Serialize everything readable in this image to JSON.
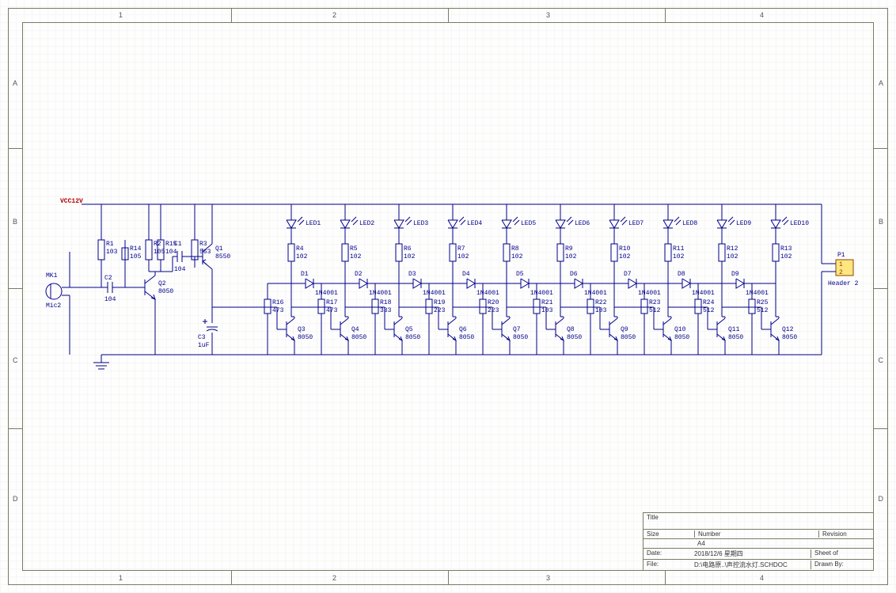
{
  "power": {
    "vcc": "VCC12V"
  },
  "mic": {
    "ref": "MK1",
    "name": "Mic2"
  },
  "pre": {
    "R1": {
      "ref": "R1",
      "val": "103"
    },
    "C2": {
      "ref": "C2",
      "val": "104"
    },
    "R2": {
      "ref": "R2",
      "val": "105"
    },
    "R14": {
      "ref": "R14",
      "val": "105"
    },
    "R15": {
      "ref": "R15",
      "val": "104"
    },
    "Q2": {
      "ref": "Q2",
      "val": "8050"
    },
    "C1": {
      "ref": "C1",
      "val": "104"
    },
    "R3": {
      "ref": "R3",
      "val": "563"
    },
    "Q1": {
      "ref": "Q1",
      "val": "8550"
    },
    "C3": {
      "ref": "C3",
      "val": "1uF"
    }
  },
  "stages": [
    {
      "led": "LED1",
      "Rtop": {
        "ref": "R4",
        "val": "102"
      },
      "Rdrv": {
        "ref": "R16",
        "val": "473"
      },
      "D": {
        "ref": "D1",
        "val": "1N4001"
      },
      "Q": {
        "ref": "Q3",
        "val": "8050"
      }
    },
    {
      "led": "LED2",
      "Rtop": {
        "ref": "R5",
        "val": "102"
      },
      "Rdrv": {
        "ref": "R17",
        "val": "473"
      },
      "D": {
        "ref": "D2",
        "val": "1N4001"
      },
      "Q": {
        "ref": "Q4",
        "val": "8050"
      }
    },
    {
      "led": "LED3",
      "Rtop": {
        "ref": "R6",
        "val": "102"
      },
      "Rdrv": {
        "ref": "R18",
        "val": "333"
      },
      "D": {
        "ref": "D3",
        "val": "1N4001"
      },
      "Q": {
        "ref": "Q5",
        "val": "8050"
      }
    },
    {
      "led": "LED4",
      "Rtop": {
        "ref": "R7",
        "val": "102"
      },
      "Rdrv": {
        "ref": "R19",
        "val": "223"
      },
      "D": {
        "ref": "D4",
        "val": "1N4001"
      },
      "Q": {
        "ref": "Q6",
        "val": "8050"
      }
    },
    {
      "led": "LED5",
      "Rtop": {
        "ref": "R8",
        "val": "102"
      },
      "Rdrv": {
        "ref": "R20",
        "val": "223"
      },
      "D": {
        "ref": "D5",
        "val": "1N4001"
      },
      "Q": {
        "ref": "Q7",
        "val": "8050"
      }
    },
    {
      "led": "LED6",
      "Rtop": {
        "ref": "R9",
        "val": "102"
      },
      "Rdrv": {
        "ref": "R21",
        "val": "103"
      },
      "D": {
        "ref": "D6",
        "val": "1N4001"
      },
      "Q": {
        "ref": "Q8",
        "val": "8050"
      }
    },
    {
      "led": "LED7",
      "Rtop": {
        "ref": "R10",
        "val": "102"
      },
      "Rdrv": {
        "ref": "R22",
        "val": "103"
      },
      "D": {
        "ref": "D7",
        "val": "1N4001"
      },
      "Q": {
        "ref": "Q9",
        "val": "8050"
      }
    },
    {
      "led": "LED8",
      "Rtop": {
        "ref": "R11",
        "val": "102"
      },
      "Rdrv": {
        "ref": "R23",
        "val": "512"
      },
      "D": {
        "ref": "D8",
        "val": "1N4001"
      },
      "Q": {
        "ref": "Q10",
        "val": "8050"
      }
    },
    {
      "led": "LED9",
      "Rtop": {
        "ref": "R12",
        "val": "102"
      },
      "Rdrv": {
        "ref": "R24",
        "val": "512"
      },
      "D": {
        "ref": "D9",
        "val": "1N4001"
      },
      "Q": {
        "ref": "Q11",
        "val": "8050"
      }
    },
    {
      "led": "LED10",
      "Rtop": {
        "ref": "R13",
        "val": "102"
      },
      "Rdrv": {
        "ref": "R25",
        "val": "512"
      },
      "D": null,
      "Q": {
        "ref": "Q12",
        "val": "8050"
      }
    }
  ],
  "conn": {
    "ref": "P1",
    "pins": [
      "1",
      "2"
    ],
    "name": "Header 2"
  },
  "title_block": {
    "title_lbl": "Title",
    "title": "",
    "size_lbl": "Size",
    "size": "A4",
    "number_lbl": "Number",
    "number": "",
    "rev_lbl": "Revision",
    "rev": "",
    "date_lbl": "Date:",
    "date": "2018/12/6 星期四",
    "sheet_lbl": "Sheet   of",
    "sheet": "",
    "file_lbl": "File:",
    "file": "D:\\电路原..\\声控流水灯.SCHDOC",
    "drawn_lbl": "Drawn By:",
    "drawn": ""
  },
  "grid": {
    "cols": [
      "1",
      "2",
      "3",
      "4"
    ],
    "rows": [
      "A",
      "B",
      "C",
      "D"
    ]
  }
}
